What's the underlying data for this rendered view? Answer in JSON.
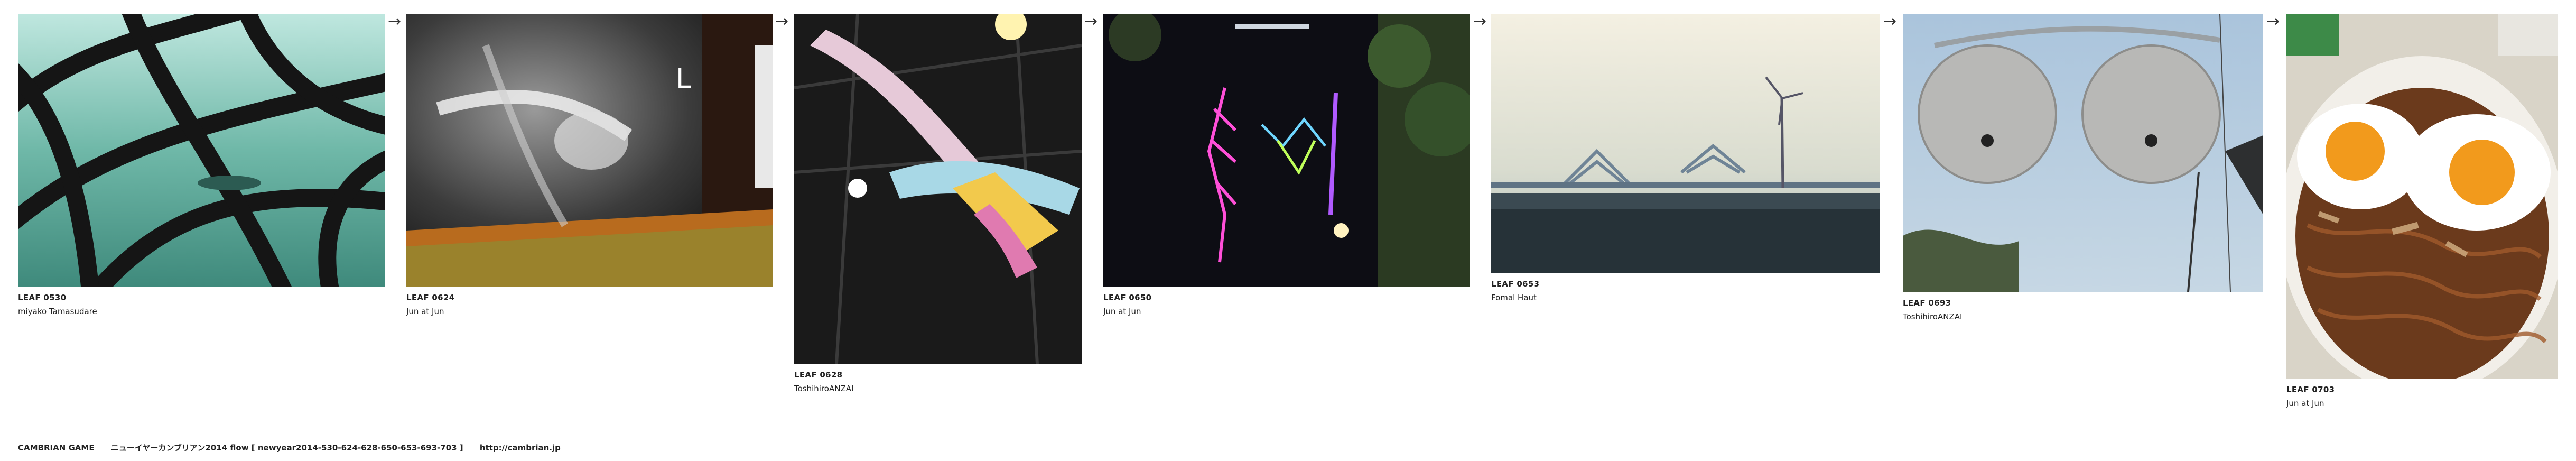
{
  "leaves": [
    {
      "title": "LEAF 0530",
      "author": "miyako Tamasudare",
      "photo": "stained-glass-window"
    },
    {
      "title": "LEAF 0624",
      "author": "Jun at Jun",
      "photo": "shoulder-xray"
    },
    {
      "title": "LEAF 0628",
      "author": "ToshihiroANZAI",
      "photo": "ribbon-sculpture"
    },
    {
      "title": "LEAF 0650",
      "author": "Jun at Jun",
      "photo": "neon-night-structure"
    },
    {
      "title": "LEAF 0653",
      "author": "Fomal Haut",
      "photo": "gate-bridge"
    },
    {
      "title": "LEAF 0693",
      "author": "ToshihiroANZAI",
      "photo": "street-lamps"
    },
    {
      "title": "LEAF 0703",
      "author": "Jun at Jun",
      "photo": "fried-eggs-noodles"
    }
  ],
  "arrow_glyph": "→",
  "footer": {
    "brand": "CAMBRIAN GAME",
    "flow": "ニューイヤーカンブリアン2014  flow [ newyear2014-530-624-628-650-653-693-703 ]",
    "url": "http://cambrian.jp"
  }
}
